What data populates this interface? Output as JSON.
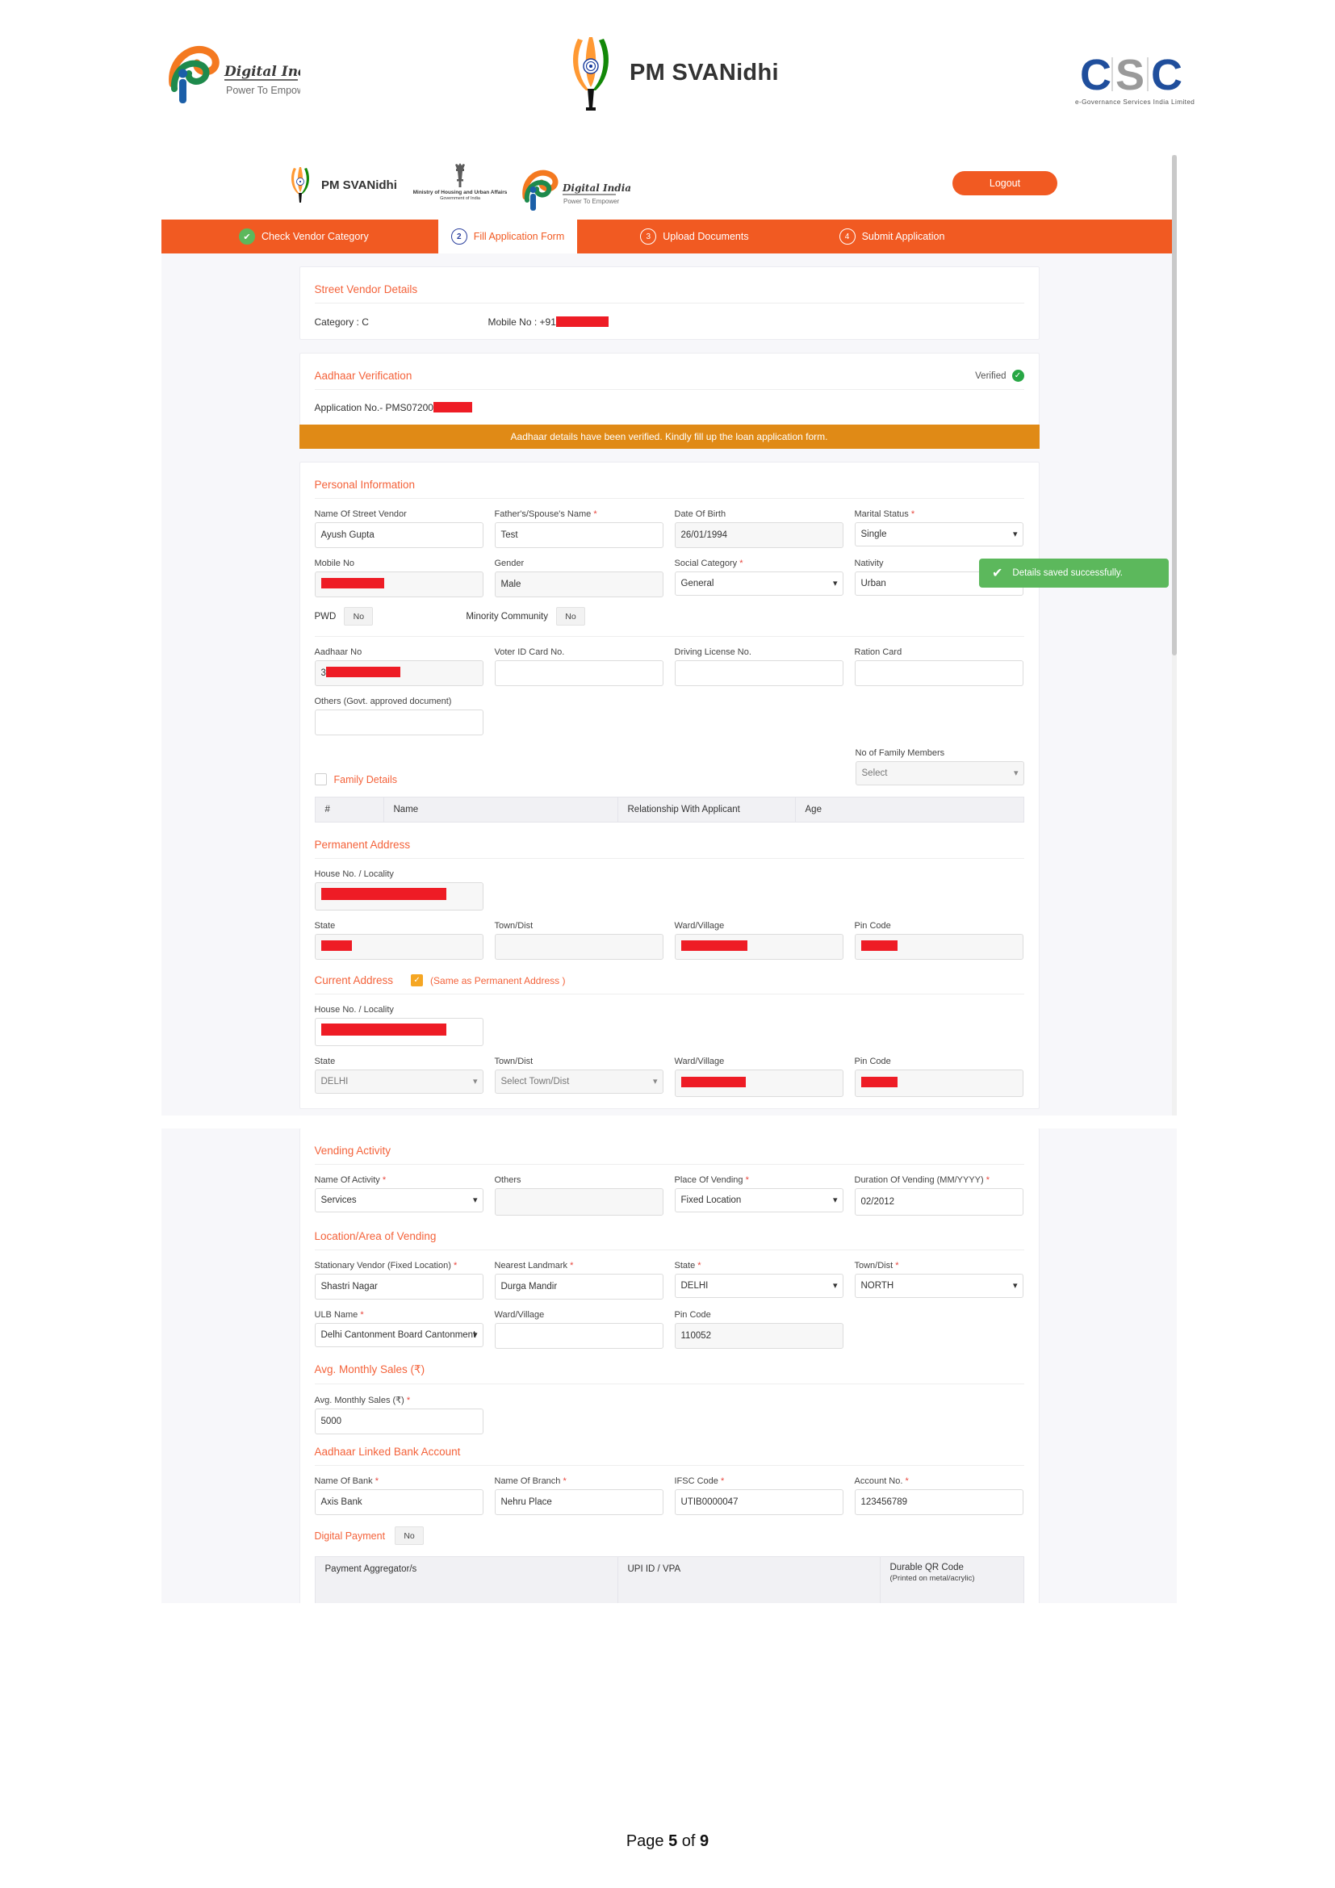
{
  "doc_header": {
    "digital_india_title": "Digital India",
    "digital_india_tagline": "Power To Empower",
    "pm_svanidhi_wordmark": "PM SVANidhi",
    "csc_wordmark": "CSC",
    "csc_tagline": "e-Governance Services India Limited"
  },
  "app": {
    "brand_name": "PM SVANidhi",
    "ministry_line1": "Ministry of Housing and Urban Affairs",
    "ministry_line2": "Government of India",
    "digital_india_title": "Digital India",
    "digital_india_tagline": "Power To Empower",
    "logout_label": "Logout"
  },
  "steps": [
    {
      "num": "✔",
      "label": "Check Vendor Category",
      "state": "done"
    },
    {
      "num": "2",
      "label": "Fill Application Form",
      "state": "active"
    },
    {
      "num": "3",
      "label": "Upload Documents",
      "state": "todo"
    },
    {
      "num": "4",
      "label": "Submit Application",
      "state": "todo"
    }
  ],
  "street_vendor": {
    "section_title": "Street Vendor Details",
    "category_label": "Category : C",
    "mobile_label": "Mobile No : +91"
  },
  "aadhaar_verification": {
    "section_title": "Aadhaar Verification",
    "verified_label": "Verified",
    "application_no_label": "Application No.- PMS07200"
  },
  "alert": {
    "message": "Aadhaar details have been verified. Kindly fill up the loan application form."
  },
  "toast": {
    "message": "Details saved successfully."
  },
  "personal_information": {
    "section_title": "Personal Information",
    "fields": {
      "name_label": "Name Of Street Vendor",
      "name_value": "Ayush Gupta",
      "father_label": "Father's/Spouse's Name",
      "father_value": "Test",
      "dob_label": "Date Of Birth",
      "dob_value": "26/01/1994",
      "marital_label": "Marital Status",
      "marital_value": "Single",
      "mobile_label": "Mobile No",
      "gender_label": "Gender",
      "gender_value": "Male",
      "social_label": "Social Category",
      "social_value": "General",
      "nativity_label": "Nativity",
      "nativity_value": "Urban",
      "pwd_label": "PWD",
      "pwd_value": "No",
      "minority_label": "Minority Community",
      "minority_value": "No",
      "aadhaar_label": "Aadhaar No",
      "aadhaar_value_prefix": "3",
      "voter_label": "Voter ID Card No.",
      "voter_value": "",
      "dl_label": "Driving License No.",
      "dl_value": "",
      "ration_label": "Ration Card",
      "ration_value": "",
      "others_label": "Others (Govt. approved document)",
      "others_value": ""
    },
    "family": {
      "checkbox_label": "Family Details",
      "count_label": "No of Family Members",
      "count_placeholder": "Select",
      "columns": [
        "#",
        "Name",
        "Relationship With Applicant",
        "Age"
      ],
      "rows": []
    }
  },
  "permanent_address": {
    "section_title": "Permanent Address",
    "house_label": "House No. / Locality",
    "state_label": "State",
    "town_label": "Town/Dist",
    "town_value": "",
    "ward_label": "Ward/Village",
    "pin_label": "Pin Code"
  },
  "current_address": {
    "section_title": "Current Address",
    "same_as_label": "(Same as Permanent Address  )",
    "house_label": "House No. / Locality",
    "state_label": "State",
    "state_value": "DELHI",
    "town_label": "Town/Dist",
    "town_placeholder": "Select Town/Dist",
    "ward_label": "Ward/Village",
    "pin_label": "Pin Code"
  },
  "vending_activity": {
    "section_title": "Vending Activity",
    "activity_label": "Name Of Activity",
    "activity_value": "Services",
    "others_label": "Others",
    "others_value": "",
    "place_label": "Place Of Vending",
    "place_value": "Fixed Location",
    "duration_label": "Duration Of Vending (MM/YYYY)",
    "duration_value": "02/2012"
  },
  "location_area": {
    "section_title": "Location/Area of Vending",
    "stationary_label": "Stationary Vendor (Fixed Location)",
    "stationary_value": "Shastri Nagar",
    "landmark_label": "Nearest Landmark",
    "landmark_value": "Durga Mandir",
    "state_label": "State",
    "state_value": "DELHI",
    "town_label": "Town/Dist",
    "town_value": "NORTH",
    "ulb_label": "ULB Name",
    "ulb_value": "Delhi Cantonment Board Cantonment",
    "ward_label": "Ward/Village",
    "ward_value": "",
    "pin_label": "Pin Code",
    "pin_value": "110052"
  },
  "monthly_sales": {
    "section_title": "Avg. Monthly Sales (₹)",
    "field_label": "Avg. Monthly Sales (₹)",
    "field_value": "5000"
  },
  "bank_account": {
    "section_title": "Aadhaar Linked Bank Account",
    "bank_label": "Name Of Bank",
    "bank_value": "Axis Bank",
    "branch_label": "Name Of Branch",
    "branch_value": "Nehru Place",
    "ifsc_label": "IFSC Code",
    "ifsc_value": "UTIB0000047",
    "account_label": "Account No.",
    "account_value": "123456789"
  },
  "digital_payment": {
    "section_title": "Digital Payment",
    "toggle_value": "No",
    "columns": [
      "Payment Aggregator/s",
      "UPI ID / VPA",
      "Durable QR Code"
    ],
    "qr_sub": "(Printed on metal/acrylic)"
  },
  "footer": {
    "page_prefix": "Page ",
    "page_number": "5",
    "page_mid": " of ",
    "page_total": "9"
  },
  "colors": {
    "brand_orange": "#f15a22",
    "section_heading": "#f4623a",
    "alert_orange": "#e08a16",
    "success_green": "#5cb85c",
    "redaction_red": "#ee1c25"
  }
}
